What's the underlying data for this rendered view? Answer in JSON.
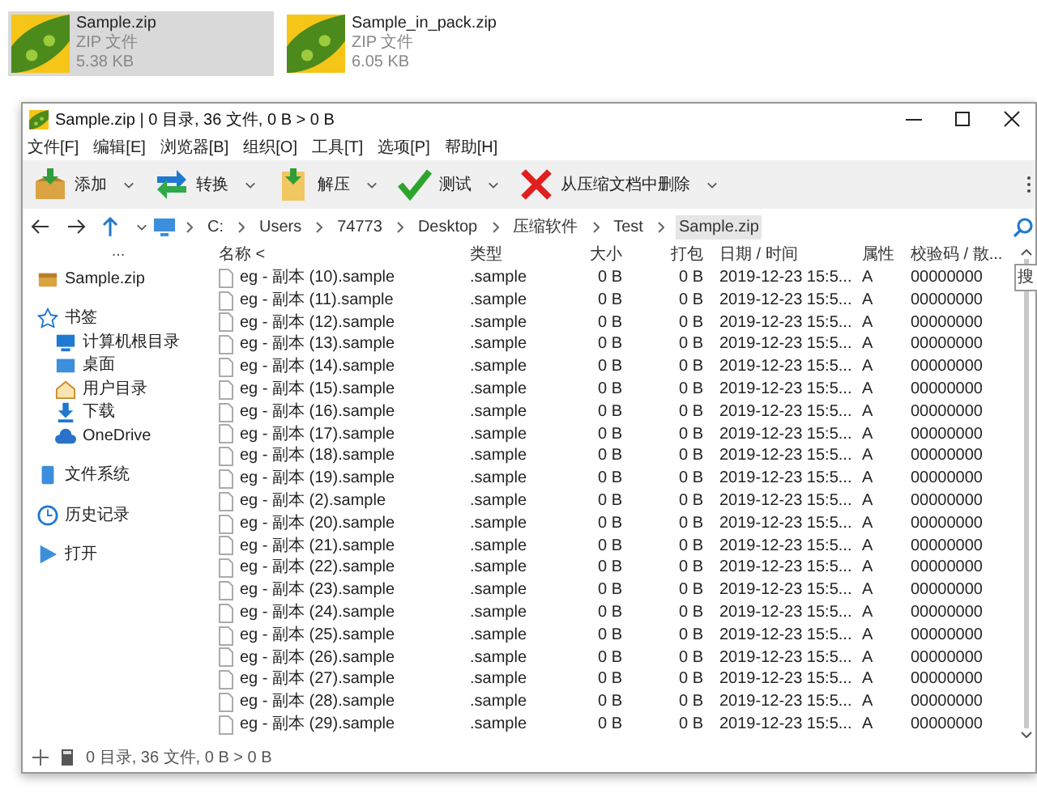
{
  "desktop_files": [
    {
      "name": "Sample.zip",
      "type": "ZIP 文件",
      "size": "5.38 KB",
      "selected": true
    },
    {
      "name": "Sample_in_pack.zip",
      "type": "ZIP 文件",
      "size": "6.05 KB",
      "selected": false
    }
  ],
  "window": {
    "title": "Sample.zip | 0 目录,  36 文件,  0 B > 0 B"
  },
  "menu": [
    "文件[F]",
    "编辑[E]",
    "浏览器[B]",
    "组织[O]",
    "工具[T]",
    "选项[P]",
    "帮助[H]"
  ],
  "toolbar": [
    {
      "kind": "add",
      "label": "添加"
    },
    {
      "kind": "convert",
      "label": "转换"
    },
    {
      "kind": "extract",
      "label": "解压"
    },
    {
      "kind": "test",
      "label": "测试"
    },
    {
      "kind": "delete",
      "label": "从压缩文档中删除"
    }
  ],
  "breadcrumb": [
    {
      "label": "C:",
      "selected": false
    },
    {
      "label": "Users",
      "selected": false
    },
    {
      "label": "74773",
      "selected": false
    },
    {
      "label": "Desktop",
      "selected": false
    },
    {
      "label": "压缩软件",
      "selected": false
    },
    {
      "label": "Test",
      "selected": false
    },
    {
      "label": "Sample.zip",
      "selected": true
    }
  ],
  "search_tooltip": "搜",
  "sidebar": {
    "header": "...",
    "items": [
      {
        "kind": "archive",
        "label": "Sample.zip"
      },
      {
        "kind": "star",
        "label": "书签",
        "children": [
          {
            "kind": "computer",
            "label": "计算机根目录"
          },
          {
            "kind": "desktop",
            "label": "桌面"
          },
          {
            "kind": "home",
            "label": "用户目录"
          },
          {
            "kind": "download",
            "label": "下载"
          },
          {
            "kind": "cloud",
            "label": "OneDrive"
          }
        ]
      },
      {
        "kind": "drive",
        "label": "文件系统"
      },
      {
        "kind": "history",
        "label": "历史记录"
      },
      {
        "kind": "play",
        "label": "打开"
      }
    ]
  },
  "table": {
    "columns": [
      "名称 <",
      "类型",
      "大小",
      "打包",
      "日期 / 时间",
      "属性",
      "校验码 / 散..."
    ],
    "rows": [
      [
        "eg - 副本 (10).sample",
        ".sample",
        "0 B",
        "0 B",
        "2019-12-23 15:5...",
        "A",
        "00000000"
      ],
      [
        "eg - 副本 (11).sample",
        ".sample",
        "0 B",
        "0 B",
        "2019-12-23 15:5...",
        "A",
        "00000000"
      ],
      [
        "eg - 副本 (12).sample",
        ".sample",
        "0 B",
        "0 B",
        "2019-12-23 15:5...",
        "A",
        "00000000"
      ],
      [
        "eg - 副本 (13).sample",
        ".sample",
        "0 B",
        "0 B",
        "2019-12-23 15:5...",
        "A",
        "00000000"
      ],
      [
        "eg - 副本 (14).sample",
        ".sample",
        "0 B",
        "0 B",
        "2019-12-23 15:5...",
        "A",
        "00000000"
      ],
      [
        "eg - 副本 (15).sample",
        ".sample",
        "0 B",
        "0 B",
        "2019-12-23 15:5...",
        "A",
        "00000000"
      ],
      [
        "eg - 副本 (16).sample",
        ".sample",
        "0 B",
        "0 B",
        "2019-12-23 15:5...",
        "A",
        "00000000"
      ],
      [
        "eg - 副本 (17).sample",
        ".sample",
        "0 B",
        "0 B",
        "2019-12-23 15:5...",
        "A",
        "00000000"
      ],
      [
        "eg - 副本 (18).sample",
        ".sample",
        "0 B",
        "0 B",
        "2019-12-23 15:5...",
        "A",
        "00000000"
      ],
      [
        "eg - 副本 (19).sample",
        ".sample",
        "0 B",
        "0 B",
        "2019-12-23 15:5...",
        "A",
        "00000000"
      ],
      [
        "eg - 副本 (2).sample",
        ".sample",
        "0 B",
        "0 B",
        "2019-12-23 15:5...",
        "A",
        "00000000"
      ],
      [
        "eg - 副本 (20).sample",
        ".sample",
        "0 B",
        "0 B",
        "2019-12-23 15:5...",
        "A",
        "00000000"
      ],
      [
        "eg - 副本 (21).sample",
        ".sample",
        "0 B",
        "0 B",
        "2019-12-23 15:5...",
        "A",
        "00000000"
      ],
      [
        "eg - 副本 (22).sample",
        ".sample",
        "0 B",
        "0 B",
        "2019-12-23 15:5...",
        "A",
        "00000000"
      ],
      [
        "eg - 副本 (23).sample",
        ".sample",
        "0 B",
        "0 B",
        "2019-12-23 15:5...",
        "A",
        "00000000"
      ],
      [
        "eg - 副本 (24).sample",
        ".sample",
        "0 B",
        "0 B",
        "2019-12-23 15:5...",
        "A",
        "00000000"
      ],
      [
        "eg - 副本 (25).sample",
        ".sample",
        "0 B",
        "0 B",
        "2019-12-23 15:5...",
        "A",
        "00000000"
      ],
      [
        "eg - 副本 (26).sample",
        ".sample",
        "0 B",
        "0 B",
        "2019-12-23 15:5...",
        "A",
        "00000000"
      ],
      [
        "eg - 副本 (27).sample",
        ".sample",
        "0 B",
        "0 B",
        "2019-12-23 15:5...",
        "A",
        "00000000"
      ],
      [
        "eg - 副本 (28).sample",
        ".sample",
        "0 B",
        "0 B",
        "2019-12-23 15:5...",
        "A",
        "00000000"
      ],
      [
        "eg - 副本 (29).sample",
        ".sample",
        "0 B",
        "0 B",
        "2019-12-23 15:5...",
        "A",
        "00000000"
      ]
    ]
  },
  "status_bar": "0 目录,  36 文件,  0 B > 0 B"
}
